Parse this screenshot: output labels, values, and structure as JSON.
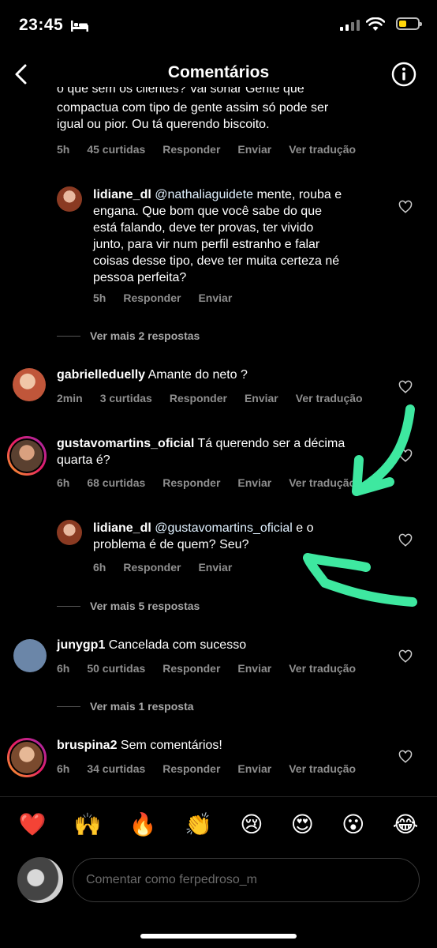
{
  "status_bar": {
    "time": "23:45"
  },
  "header": {
    "title": "Comentários"
  },
  "top_comment": {
    "lines": [
      "o que sem os clientes? Vai sonar Gente que",
      "compactua com tipo de gente assim só pode ser",
      "igual ou pior. Ou tá querendo biscoito."
    ],
    "time": "5h",
    "likes": "45 curtidas",
    "reply": "Responder",
    "send": "Enviar",
    "translate": "Ver tradução"
  },
  "reply1": {
    "user": "lidiane_dl",
    "mention": "@nathaliaguidete",
    "line1_rest": " mente, rouba e",
    "lines": [
      "engana. Que bom que você sabe do que",
      "está falando, deve ter provas, ter vivido",
      "junto, para vir num perfil estranho e falar",
      "coisas desse tipo, deve ter muita certeza né",
      "pessoa perfeita?"
    ],
    "time": "5h",
    "reply": "Responder",
    "send": "Enviar"
  },
  "more1": "Ver mais 2 respostas",
  "comment2": {
    "user": "gabrielleduelly",
    "text": " Amante do neto ?",
    "time": "2min",
    "likes": "3 curtidas",
    "reply": "Responder",
    "send": "Enviar",
    "translate": "Ver tradução"
  },
  "comment3": {
    "user": "gustavomartins_oficial",
    "text": " Tá querendo ser a décima",
    "line2": "quarta é?",
    "time": "6h",
    "likes": "68 curtidas",
    "reply": "Responder",
    "send": "Enviar",
    "translate": "Ver tradução"
  },
  "reply2": {
    "user": "lidiane_dl",
    "mention": "@gustavomartins_oficial",
    "rest": " e o",
    "line2": "problema é de quem? Seu?",
    "time": "6h",
    "reply": "Responder",
    "send": "Enviar"
  },
  "more2": "Ver mais 5 respostas",
  "comment4": {
    "user": "junygp1",
    "text": " Cancelada com sucesso",
    "time": "6h",
    "likes": "50 curtidas",
    "reply": "Responder",
    "send": "Enviar",
    "translate": "Ver tradução"
  },
  "more3": "Ver mais 1 resposta",
  "comment5": {
    "user": "bruspina2",
    "text": " Sem comentários!",
    "time": "6h",
    "likes": "34 curtidas",
    "reply": "Responder",
    "send": "Enviar",
    "translate": "Ver tradução"
  },
  "emojis": [
    "❤️",
    "🙌",
    "🔥",
    "👏",
    "😢",
    "😍",
    "😮",
    "😂"
  ],
  "input": {
    "placeholder": "Comentar como ferpedroso_m"
  },
  "colors": {
    "background": "#000000",
    "meta": "#8e8e8e",
    "annotation": "#3ee8a0"
  }
}
